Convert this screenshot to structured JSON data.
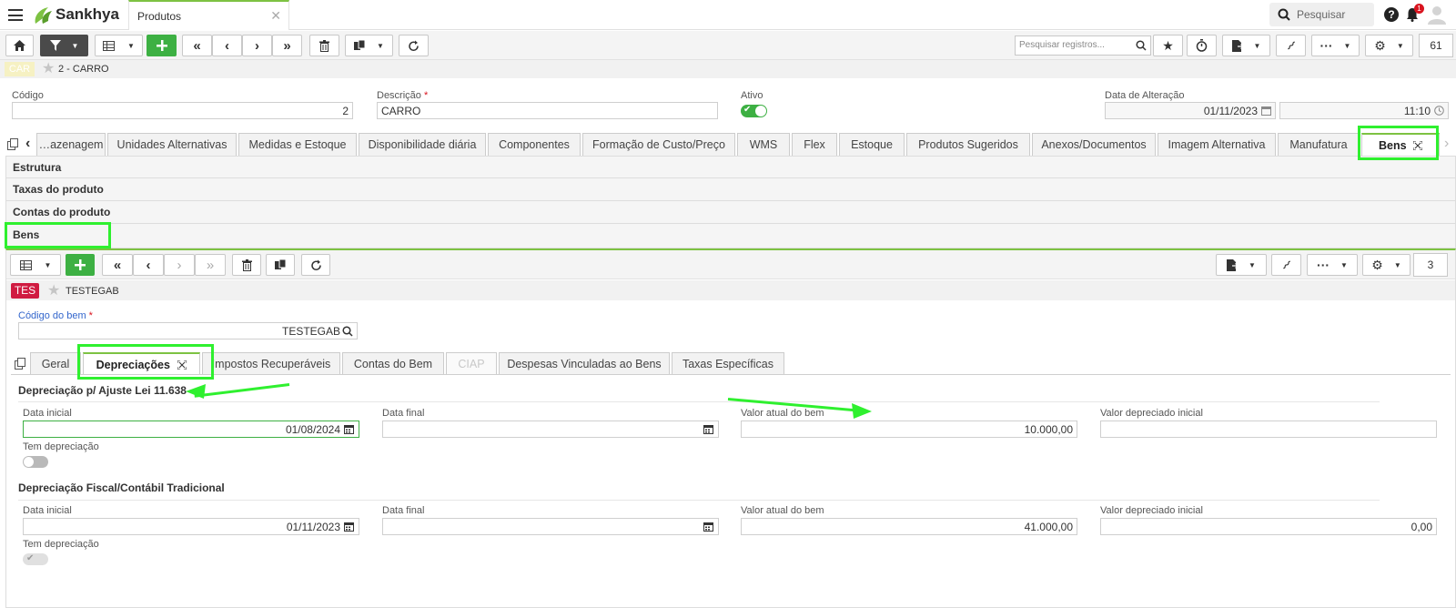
{
  "app": {
    "brand": "Sankhya",
    "brand_color": "#7dc242"
  },
  "top": {
    "tab_title": "Produtos",
    "search_placeholder": "Pesquisar",
    "notification_count": "1"
  },
  "toolbar": {
    "records_search_placeholder": "Pesquisar registros...",
    "record_count": "61"
  },
  "record": {
    "badge": "CAR",
    "title": "2 - CARRO"
  },
  "fields": {
    "codigo_label": "Código",
    "codigo_value": "2",
    "descricao_label": "Descrição",
    "descricao_value": "CARRO",
    "ativo_label": "Ativo",
    "data_alteracao_label": "Data de Alteração",
    "data_value": "01/11/2023",
    "hora_value": "11:10"
  },
  "tabs": [
    "…azenagem",
    "Unidades Alternativas",
    "Medidas e Estoque",
    "Disponibilidade diária",
    "Componentes",
    "Formação de Custo/Preço",
    "WMS",
    "Flex",
    "Estoque",
    "Produtos Sugeridos",
    "Anexos/Documentos",
    "Imagem Alternativa",
    "Manufatura",
    "Bens"
  ],
  "accordion": [
    "Estrutura",
    "Taxas do produto",
    "Contas do produto",
    "Bens"
  ],
  "sub": {
    "record_count": "3",
    "badge": "TES",
    "badge_color": "#d01b41",
    "title": "TESTEGAB",
    "codigo_bem_label": "Código do bem",
    "codigo_bem_value": "TESTEGAB",
    "tabs": [
      "Geral",
      "Depreciações",
      "Impostos Recuperáveis",
      "Contas do Bem",
      "CIAP",
      "Despesas Vinculadas ao Bens",
      "Taxas Específicas"
    ]
  },
  "dep1": {
    "title": "Depreciação p/ Ajuste Lei 11.638",
    "data_inicial_label": "Data inicial",
    "data_inicial": "01/08/2024",
    "data_final_label": "Data final",
    "data_final": "",
    "valor_atual_label": "Valor atual do bem",
    "valor_atual": "10.000,00",
    "valor_dep_label": "Valor depreciado inicial",
    "valor_dep": "",
    "tem_dep_label": "Tem depreciação"
  },
  "dep2": {
    "title": "Depreciação Fiscal/Contábil Tradicional",
    "data_inicial_label": "Data inicial",
    "data_inicial": "01/11/2023",
    "data_final_label": "Data final",
    "data_final": "",
    "valor_atual_label": "Valor atual do bem",
    "valor_atual": "41.000,00",
    "valor_dep_label": "Valor depreciado inicial",
    "valor_dep": "0,00",
    "tem_dep_label": "Tem depreciação"
  }
}
